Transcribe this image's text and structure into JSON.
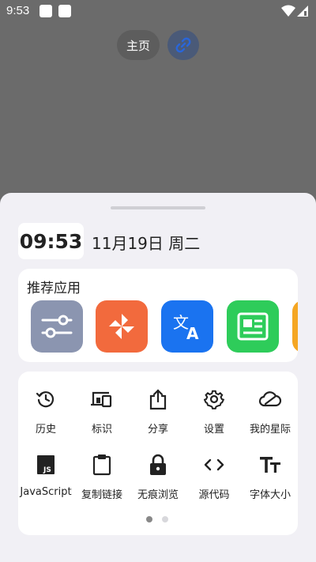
{
  "status_bar": {
    "time": "9:53"
  },
  "top": {
    "home_label": "主页",
    "link_icon": "link-icon"
  },
  "sheet": {
    "clock": "09:53",
    "date": "11月19日 周二",
    "recommended": {
      "title": "推荐应用",
      "apps": [
        {
          "name": "settings-sliders-app-icon",
          "color": "#8b95b0"
        },
        {
          "name": "pinwheel-app-icon",
          "color": "#f26a3d"
        },
        {
          "name": "translate-app-icon",
          "color": "#1a73f0"
        },
        {
          "name": "news-app-icon",
          "color": "#2ecc5a"
        },
        {
          "name": "partial-app-icon",
          "color": "#f5a623"
        }
      ]
    },
    "actions": [
      {
        "label": "历史",
        "icon": "history-icon"
      },
      {
        "label": "标识",
        "icon": "devices-icon"
      },
      {
        "label": "分享",
        "icon": "share-icon"
      },
      {
        "label": "设置",
        "icon": "gear-icon"
      },
      {
        "label": "我的星际",
        "icon": "cloud-icon"
      },
      {
        "label": "JavaScript",
        "icon": "js-icon"
      },
      {
        "label": "复制链接",
        "icon": "clipboard-icon"
      },
      {
        "label": "无痕浏览",
        "icon": "lock-icon"
      },
      {
        "label": "源代码",
        "icon": "code-icon"
      },
      {
        "label": "字体大小",
        "icon": "font-size-icon"
      }
    ],
    "pagination": {
      "pages": 2,
      "current": 1
    }
  }
}
